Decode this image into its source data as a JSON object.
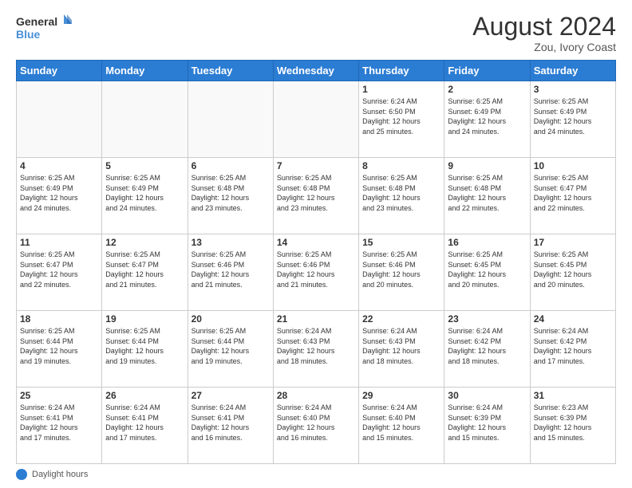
{
  "header": {
    "logo_line1": "General",
    "logo_line2": "Blue",
    "month_title": "August 2024",
    "location": "Zou, Ivory Coast"
  },
  "footer": {
    "daylight_label": "Daylight hours"
  },
  "weekdays": [
    "Sunday",
    "Monday",
    "Tuesday",
    "Wednesday",
    "Thursday",
    "Friday",
    "Saturday"
  ],
  "weeks": [
    [
      {
        "day": "",
        "info": ""
      },
      {
        "day": "",
        "info": ""
      },
      {
        "day": "",
        "info": ""
      },
      {
        "day": "",
        "info": ""
      },
      {
        "day": "1",
        "info": "Sunrise: 6:24 AM\nSunset: 6:50 PM\nDaylight: 12 hours\nand 25 minutes."
      },
      {
        "day": "2",
        "info": "Sunrise: 6:25 AM\nSunset: 6:49 PM\nDaylight: 12 hours\nand 24 minutes."
      },
      {
        "day": "3",
        "info": "Sunrise: 6:25 AM\nSunset: 6:49 PM\nDaylight: 12 hours\nand 24 minutes."
      }
    ],
    [
      {
        "day": "4",
        "info": "Sunrise: 6:25 AM\nSunset: 6:49 PM\nDaylight: 12 hours\nand 24 minutes."
      },
      {
        "day": "5",
        "info": "Sunrise: 6:25 AM\nSunset: 6:49 PM\nDaylight: 12 hours\nand 24 minutes."
      },
      {
        "day": "6",
        "info": "Sunrise: 6:25 AM\nSunset: 6:48 PM\nDaylight: 12 hours\nand 23 minutes."
      },
      {
        "day": "7",
        "info": "Sunrise: 6:25 AM\nSunset: 6:48 PM\nDaylight: 12 hours\nand 23 minutes."
      },
      {
        "day": "8",
        "info": "Sunrise: 6:25 AM\nSunset: 6:48 PM\nDaylight: 12 hours\nand 23 minutes."
      },
      {
        "day": "9",
        "info": "Sunrise: 6:25 AM\nSunset: 6:48 PM\nDaylight: 12 hours\nand 22 minutes."
      },
      {
        "day": "10",
        "info": "Sunrise: 6:25 AM\nSunset: 6:47 PM\nDaylight: 12 hours\nand 22 minutes."
      }
    ],
    [
      {
        "day": "11",
        "info": "Sunrise: 6:25 AM\nSunset: 6:47 PM\nDaylight: 12 hours\nand 22 minutes."
      },
      {
        "day": "12",
        "info": "Sunrise: 6:25 AM\nSunset: 6:47 PM\nDaylight: 12 hours\nand 21 minutes."
      },
      {
        "day": "13",
        "info": "Sunrise: 6:25 AM\nSunset: 6:46 PM\nDaylight: 12 hours\nand 21 minutes."
      },
      {
        "day": "14",
        "info": "Sunrise: 6:25 AM\nSunset: 6:46 PM\nDaylight: 12 hours\nand 21 minutes."
      },
      {
        "day": "15",
        "info": "Sunrise: 6:25 AM\nSunset: 6:46 PM\nDaylight: 12 hours\nand 20 minutes."
      },
      {
        "day": "16",
        "info": "Sunrise: 6:25 AM\nSunset: 6:45 PM\nDaylight: 12 hours\nand 20 minutes."
      },
      {
        "day": "17",
        "info": "Sunrise: 6:25 AM\nSunset: 6:45 PM\nDaylight: 12 hours\nand 20 minutes."
      }
    ],
    [
      {
        "day": "18",
        "info": "Sunrise: 6:25 AM\nSunset: 6:44 PM\nDaylight: 12 hours\nand 19 minutes."
      },
      {
        "day": "19",
        "info": "Sunrise: 6:25 AM\nSunset: 6:44 PM\nDaylight: 12 hours\nand 19 minutes."
      },
      {
        "day": "20",
        "info": "Sunrise: 6:25 AM\nSunset: 6:44 PM\nDaylight: 12 hours\nand 19 minutes."
      },
      {
        "day": "21",
        "info": "Sunrise: 6:24 AM\nSunset: 6:43 PM\nDaylight: 12 hours\nand 18 minutes."
      },
      {
        "day": "22",
        "info": "Sunrise: 6:24 AM\nSunset: 6:43 PM\nDaylight: 12 hours\nand 18 minutes."
      },
      {
        "day": "23",
        "info": "Sunrise: 6:24 AM\nSunset: 6:42 PM\nDaylight: 12 hours\nand 18 minutes."
      },
      {
        "day": "24",
        "info": "Sunrise: 6:24 AM\nSunset: 6:42 PM\nDaylight: 12 hours\nand 17 minutes."
      }
    ],
    [
      {
        "day": "25",
        "info": "Sunrise: 6:24 AM\nSunset: 6:41 PM\nDaylight: 12 hours\nand 17 minutes."
      },
      {
        "day": "26",
        "info": "Sunrise: 6:24 AM\nSunset: 6:41 PM\nDaylight: 12 hours\nand 17 minutes."
      },
      {
        "day": "27",
        "info": "Sunrise: 6:24 AM\nSunset: 6:41 PM\nDaylight: 12 hours\nand 16 minutes."
      },
      {
        "day": "28",
        "info": "Sunrise: 6:24 AM\nSunset: 6:40 PM\nDaylight: 12 hours\nand 16 minutes."
      },
      {
        "day": "29",
        "info": "Sunrise: 6:24 AM\nSunset: 6:40 PM\nDaylight: 12 hours\nand 15 minutes."
      },
      {
        "day": "30",
        "info": "Sunrise: 6:24 AM\nSunset: 6:39 PM\nDaylight: 12 hours\nand 15 minutes."
      },
      {
        "day": "31",
        "info": "Sunrise: 6:23 AM\nSunset: 6:39 PM\nDaylight: 12 hours\nand 15 minutes."
      }
    ]
  ]
}
